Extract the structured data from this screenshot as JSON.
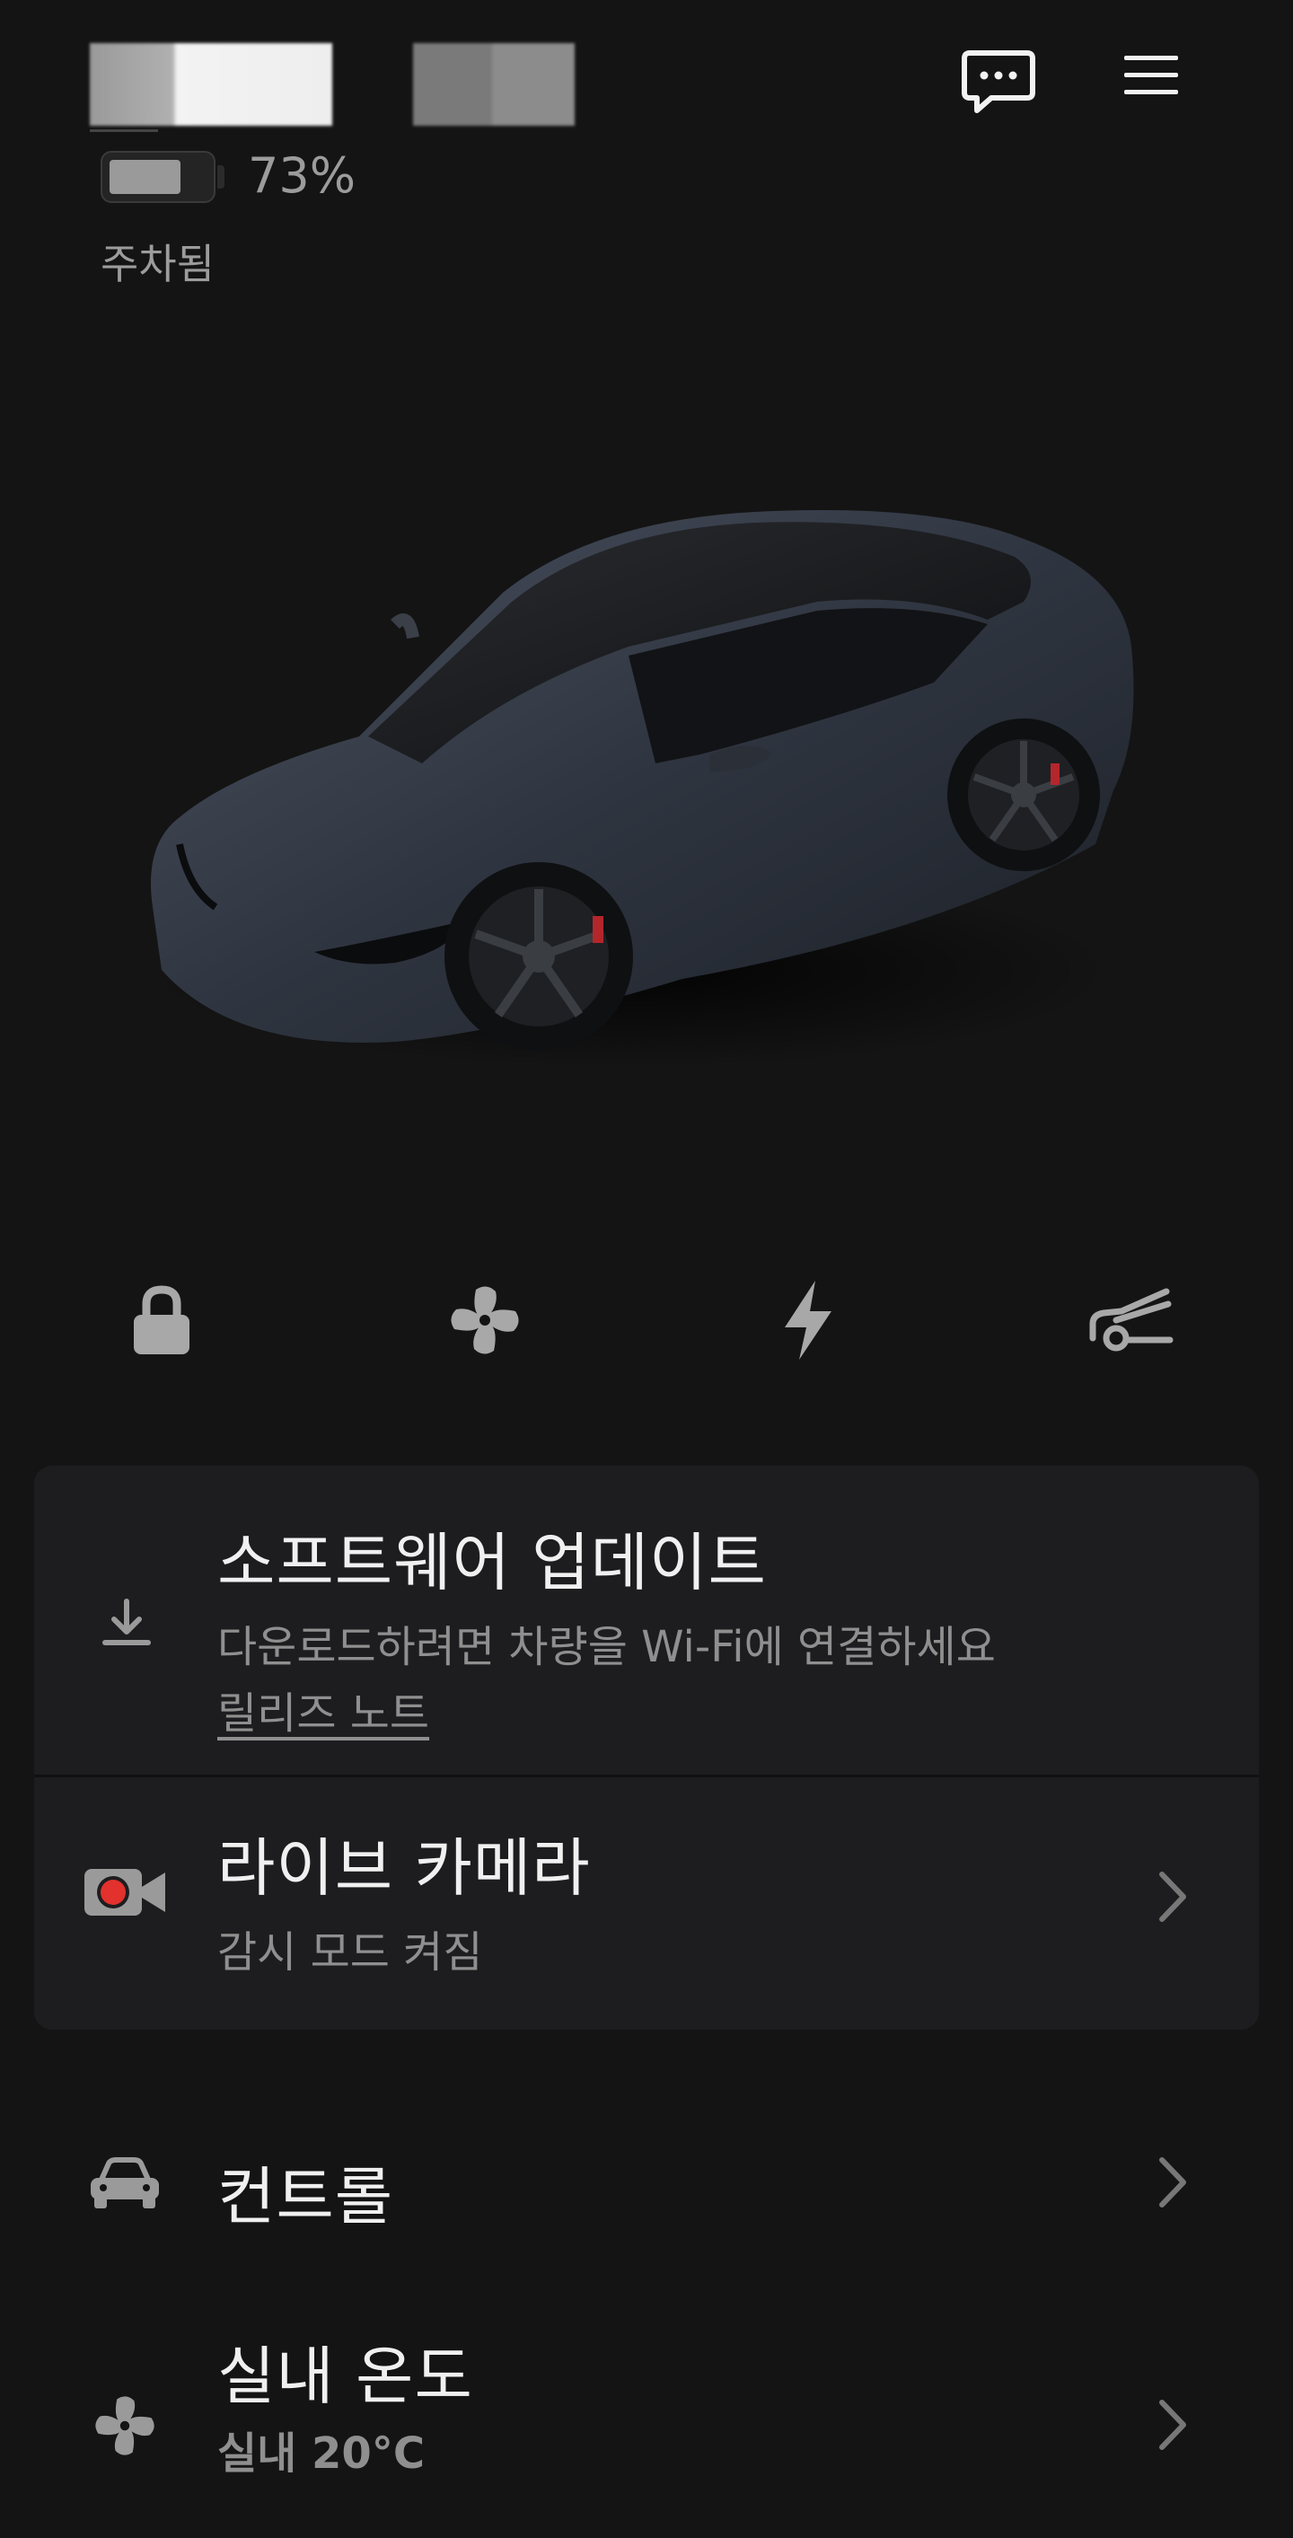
{
  "header": {
    "battery_percent": 73,
    "battery_text": "73%",
    "status": "주차됨"
  },
  "quick_actions": [
    {
      "icon": "lock-icon"
    },
    {
      "icon": "fan-icon"
    },
    {
      "icon": "bolt-icon"
    },
    {
      "icon": "trunk-icon"
    }
  ],
  "software_update": {
    "title": "소프트웨어 업데이트",
    "subtitle": "다운로드하려면 차량을 Wi-Fi에 연결하세요",
    "link": "릴리즈 노트",
    "icon": "download-icon"
  },
  "live_camera": {
    "title": "라이브 카메라",
    "subtitle": "감시 모드 켜짐",
    "icon": "camera-record-icon"
  },
  "controls": {
    "title": "컨트롤",
    "icon": "car-icon"
  },
  "climate": {
    "title": "실내 온도",
    "subtitle": "실내 20°C",
    "icon": "fan-icon"
  },
  "colors": {
    "background": "#141414",
    "card": "#1d1d1f",
    "record_red": "#e3312d"
  }
}
